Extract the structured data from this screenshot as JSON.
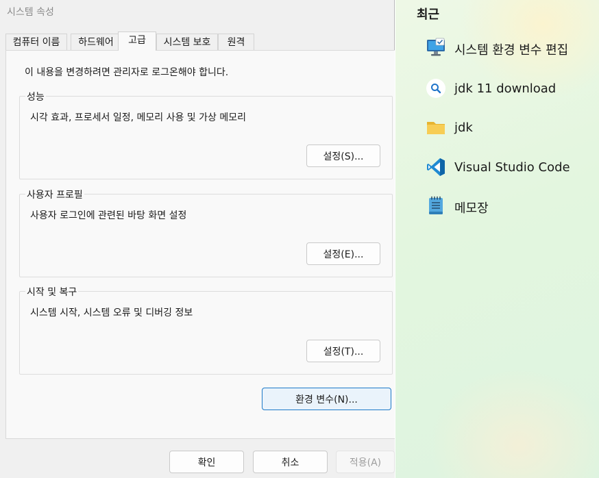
{
  "dialog": {
    "title": "시스템 속성",
    "tabs": [
      "컴퓨터 이름",
      "하드웨어",
      "고급",
      "시스템 보호",
      "원격"
    ],
    "admin_note": "이 내용을 변경하려면 관리자로 로그온해야 합니다.",
    "groups": {
      "performance": {
        "legend": "성능",
        "description": "시각 효과, 프로세서 일정, 메모리 사용 및 가상 메모리",
        "button": "설정(S)..."
      },
      "user_profiles": {
        "legend": "사용자 프로필",
        "description": "사용자 로그인에 관련된 바탕 화면 설정",
        "button": "설정(E)..."
      },
      "startup_recovery": {
        "legend": "시작 및 복구",
        "description": "시스템 시작, 시스템 오류 및 디버깅 정보",
        "button": "설정(T)..."
      }
    },
    "env_button": "환경 변수(N)...",
    "ok_button": "확인",
    "cancel_button": "취소",
    "apply_button": "적용(A)"
  },
  "recent": {
    "title": "최근",
    "items": [
      {
        "label": "시스템 환경 변수 편집",
        "icon": "system-settings-icon"
      },
      {
        "label": "jdk 11 download",
        "icon": "web-search-icon"
      },
      {
        "label": "jdk",
        "icon": "folder-icon"
      },
      {
        "label": "Visual Studio Code",
        "icon": "vscode-icon"
      },
      {
        "label": "메모장",
        "icon": "notepad-icon"
      }
    ]
  },
  "colors": {
    "accent_border": "#1b78c8",
    "vscode_blue": "#1f8ad2",
    "folder_yellow": "#f7c948"
  }
}
